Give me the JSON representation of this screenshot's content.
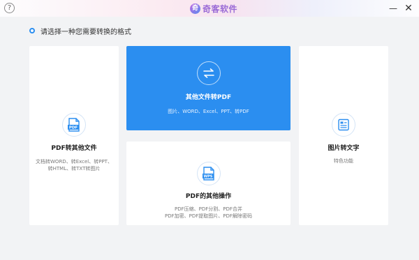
{
  "titlebar": {
    "help_label": "?",
    "logo_mark": "奇",
    "app_name": "奇客软件",
    "minimize_label": "—",
    "close_label": "✕"
  },
  "prompt": {
    "text": "请选择一种您需要转换的格式"
  },
  "cards": [
    {
      "title": "PDF转其他文件",
      "desc_line1": "文档转WORD、转Excel、转PPT、",
      "desc_line2": "转HTML、转TXT转图片",
      "icon": "pdf-file-icon",
      "icon_text": "PDF"
    },
    {
      "title": "其他文件转PDF",
      "desc_line1": "图片、WORD、Excel、PPT、转PDF",
      "icon": "swap-arrows-icon",
      "selected": true
    },
    {
      "title": "PDF的其他操作",
      "desc_line1": "PDF压缩、PDF分割、PDF合并",
      "desc_line2": "PDF加密、PDF提取图片、PDF解除密码",
      "icon": "wps-file-icon",
      "icon_text": "WPS"
    },
    {
      "title": "图片转文字",
      "desc_line1": "特色功能",
      "icon": "image-text-icon"
    }
  ],
  "colors": {
    "accent": "#2b8ef0",
    "background": "#f2f3f5"
  }
}
